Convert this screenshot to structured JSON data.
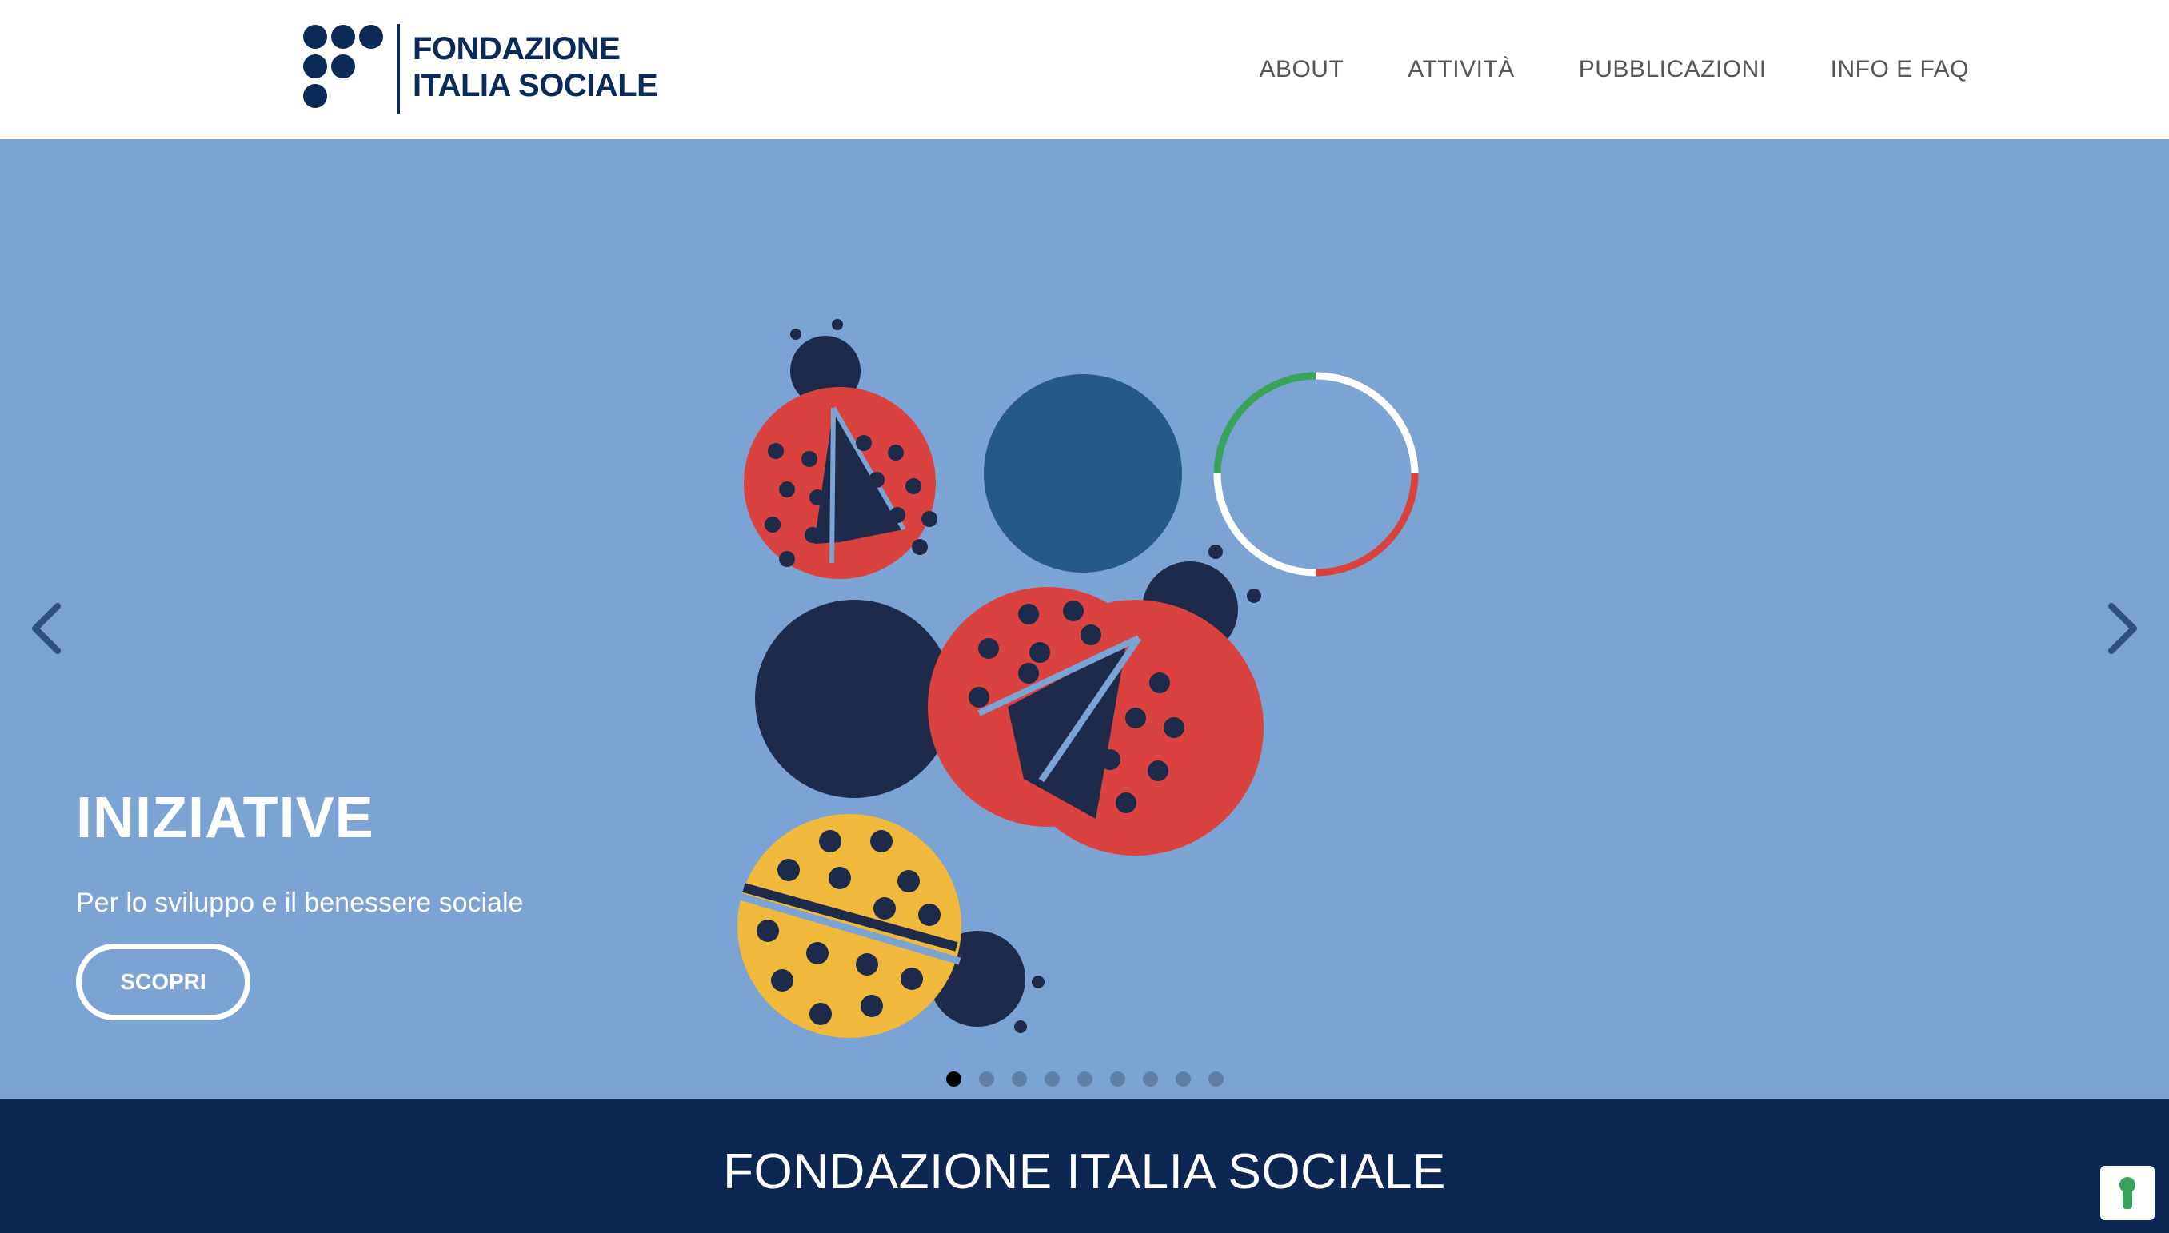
{
  "header": {
    "logo": {
      "line1": "FONDAZIONE",
      "line2": "ITALIA SOCIALE"
    },
    "nav": [
      {
        "label": "ABOUT"
      },
      {
        "label": "ATTIVITÀ"
      },
      {
        "label": "PUBBLICAZIONI"
      },
      {
        "label": "INFO E FAQ"
      }
    ]
  },
  "hero": {
    "title": "INIZIATIVE",
    "subtitle": "Per lo sviluppo e il benessere sociale",
    "button_label": "SCOPRI",
    "slide_count": 9,
    "active_slide": 1,
    "prev_icon": "chevron-left-icon",
    "next_icon": "chevron-right-icon"
  },
  "footer": {
    "title": "FONDAZIONE ITALIA SOCIALE"
  },
  "colors": {
    "brand_navy": "#0b2a57",
    "hero_bg": "#7ba3d3",
    "ladybug_red": "#d9423f",
    "ladybug_yellow": "#f0b93b",
    "dark_navy": "#1e2a4a",
    "teal_blue": "#245a8a",
    "green": "#3aa35a"
  }
}
